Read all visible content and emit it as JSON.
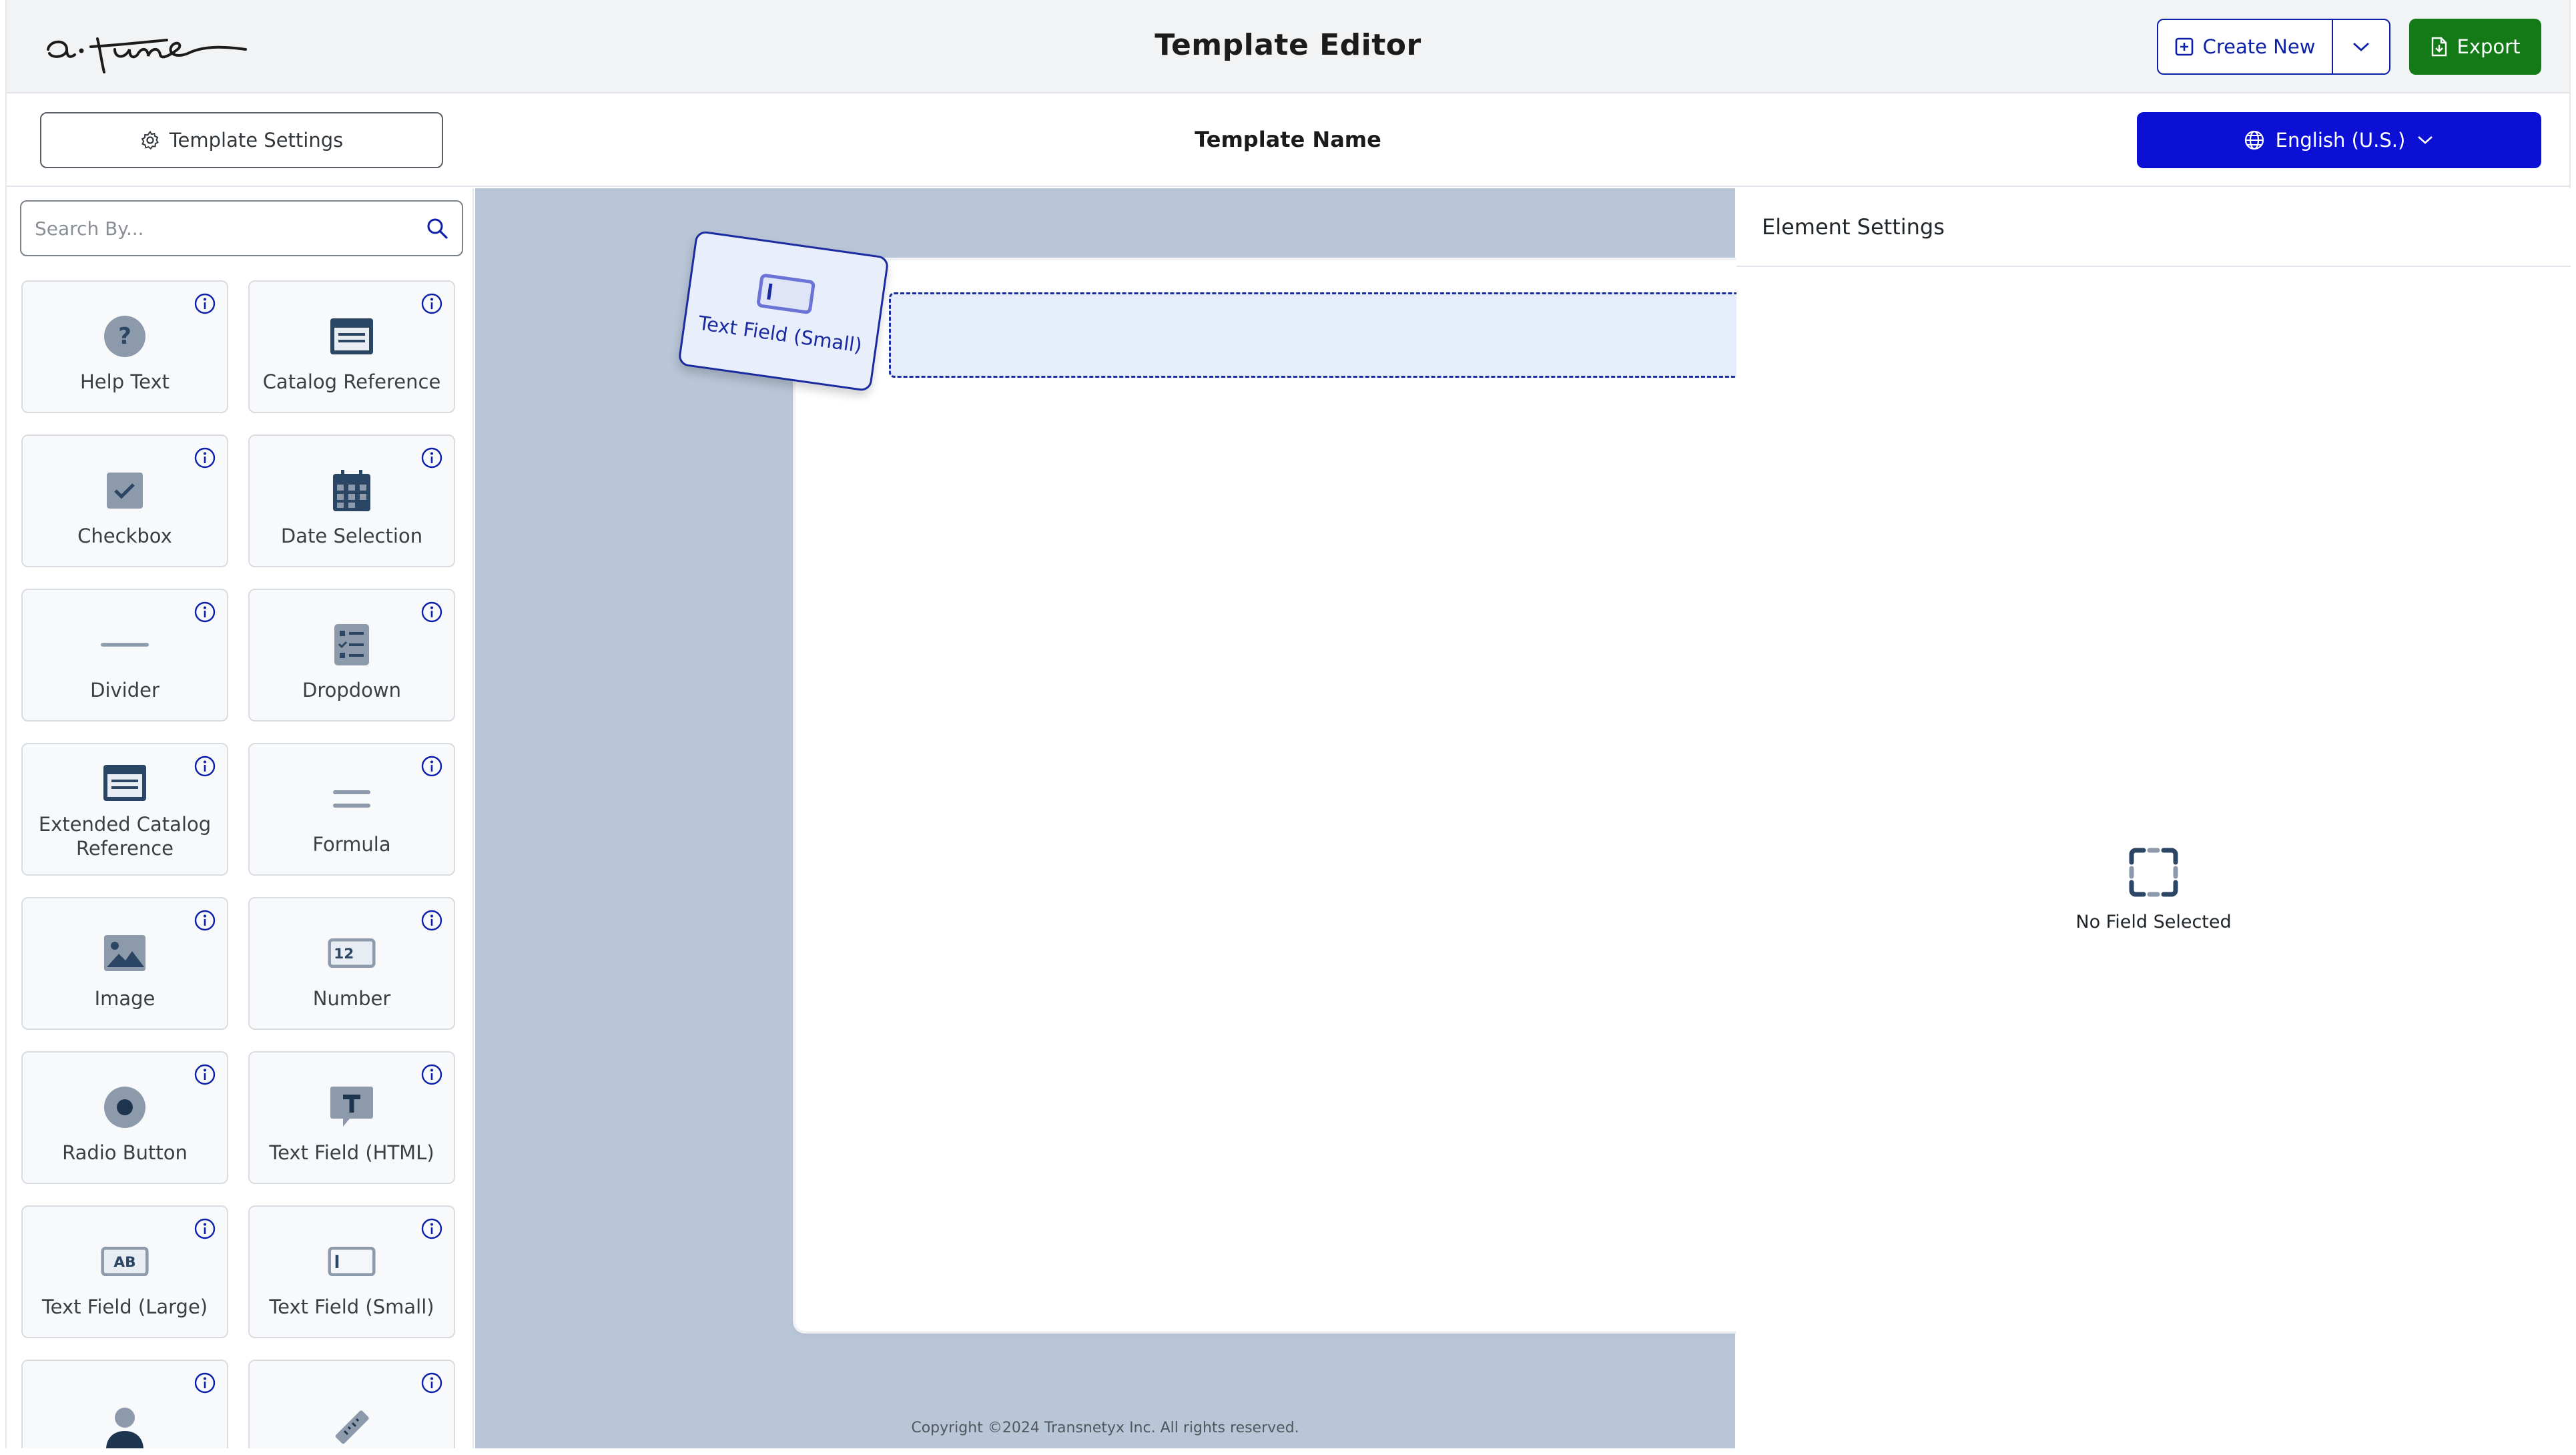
{
  "header": {
    "logo_text": "a·tune",
    "title": "Template Editor",
    "create_new_label": "Create New",
    "export_label": "Export"
  },
  "subheader": {
    "settings_label": "Template Settings",
    "template_name": "Template Name",
    "language_label": "English (U.S.)"
  },
  "palette": {
    "search_placeholder": "Search By...",
    "items": [
      {
        "label": "Help Text",
        "icon": "help-circle-icon"
      },
      {
        "label": "Catalog Reference",
        "icon": "catalog-card-icon"
      },
      {
        "label": "Checkbox",
        "icon": "checkbox-icon"
      },
      {
        "label": "Date Selection",
        "icon": "calendar-icon"
      },
      {
        "label": "Divider",
        "icon": "divider-line-icon"
      },
      {
        "label": "Dropdown",
        "icon": "dropdown-list-icon"
      },
      {
        "label": "Extended Catalog Reference",
        "icon": "catalog-card-icon"
      },
      {
        "label": "Formula",
        "icon": "equals-icon"
      },
      {
        "label": "Image",
        "icon": "image-icon"
      },
      {
        "label": "Number",
        "icon": "number-field-icon"
      },
      {
        "label": "Radio Button",
        "icon": "radio-icon"
      },
      {
        "label": "Text Field (HTML)",
        "icon": "html-text-icon"
      },
      {
        "label": "Text Field (Large)",
        "icon": "large-text-icon"
      },
      {
        "label": "Text Field (Small)",
        "icon": "small-text-icon"
      },
      {
        "label": "",
        "icon": "person-icon"
      },
      {
        "label": "",
        "icon": "ruler-icon"
      }
    ]
  },
  "canvas": {
    "drag_label": "Text Field (Small)",
    "copyright": "Copyright ©2024 Transnetyx Inc. All rights reserved."
  },
  "element_settings": {
    "title": "Element Settings",
    "empty_text": "No Field Selected"
  },
  "colors": {
    "primary_blue": "#0b10d4",
    "outline_blue": "#0b1fa8",
    "export_green": "#137a17",
    "canvas_bg": "#b9c6d8",
    "icon_dark": "#2b4564",
    "icon_muted": "#8c9aab"
  }
}
